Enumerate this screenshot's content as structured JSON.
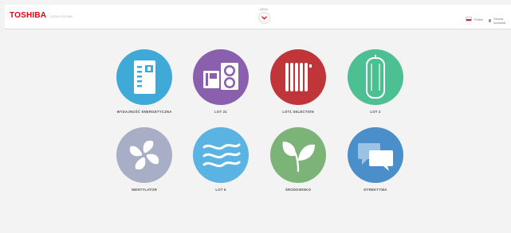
{
  "brand": {
    "logo": "TOSHIBA",
    "subtitle": "KATALOGOWA"
  },
  "header": {
    "menu_label": "MENU",
    "lang_label": "Polski",
    "home_label": "Strona domowa"
  },
  "colors": {
    "accent": "#e60012",
    "tile_1": "#3fa9d8",
    "tile_2": "#8a5fae",
    "tile_3": "#c0353a",
    "tile_4": "#4cbf93",
    "tile_5": "#a7aec5",
    "tile_6": "#5ab3e3",
    "tile_7": "#7cb478",
    "tile_8": "#4a8fc9"
  },
  "tiles": [
    {
      "label": "WYDAJNOŚĆ ENERGETYCZNA",
      "icon": "control-panel-icon"
    },
    {
      "label": "LOT 21",
      "icon": "heat-pump-units-icon"
    },
    {
      "label": "LOT1 SELECTION",
      "icon": "radiator-icon"
    },
    {
      "label": "LOT 2",
      "icon": "water-tank-icon"
    },
    {
      "label": "WENTYLATOR",
      "icon": "fan-icon"
    },
    {
      "label": "LOT 6",
      "icon": "airflow-icon"
    },
    {
      "label": "ŚRODOWISKO",
      "icon": "leaf-icon"
    },
    {
      "label": "DYREKTYWA",
      "icon": "speech-bubbles-icon"
    }
  ]
}
